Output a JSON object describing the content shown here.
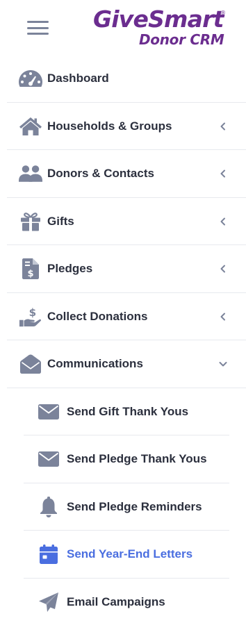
{
  "brand": {
    "name": "GiveSmart",
    "registered_mark": "®",
    "subtitle": "Donor CRM",
    "color": "#6b2d8f"
  },
  "colors": {
    "icon": "#7b839a",
    "text": "#2b2f3d",
    "active": "#4a6ee0",
    "divider": "#e7e9ee"
  },
  "menu": {
    "items": [
      {
        "label": "Dashboard",
        "icon": "dashboard-gauge-icon",
        "chevron": "none"
      },
      {
        "label": "Households & Groups",
        "icon": "home-icon",
        "chevron": "left"
      },
      {
        "label": "Donors & Contacts",
        "icon": "users-icon",
        "chevron": "left"
      },
      {
        "label": "Gifts",
        "icon": "gift-icon",
        "chevron": "left"
      },
      {
        "label": "Pledges",
        "icon": "invoice-dollar-icon",
        "chevron": "left"
      },
      {
        "label": "Collect Donations",
        "icon": "hand-holding-dollar-icon",
        "chevron": "left"
      },
      {
        "label": "Communications",
        "icon": "envelope-open-icon",
        "chevron": "down",
        "expanded": true
      }
    ],
    "communications_sub": [
      {
        "label": "Send Gift Thank Yous",
        "icon": "envelope-icon"
      },
      {
        "label": "Send Pledge Thank Yous",
        "icon": "envelope-icon"
      },
      {
        "label": "Send Pledge Reminders",
        "icon": "bell-icon"
      },
      {
        "label": "Send Year-End Letters",
        "icon": "calendar-icon",
        "active": true
      },
      {
        "label": "Email Campaigns",
        "icon": "paper-plane-icon"
      }
    ]
  }
}
